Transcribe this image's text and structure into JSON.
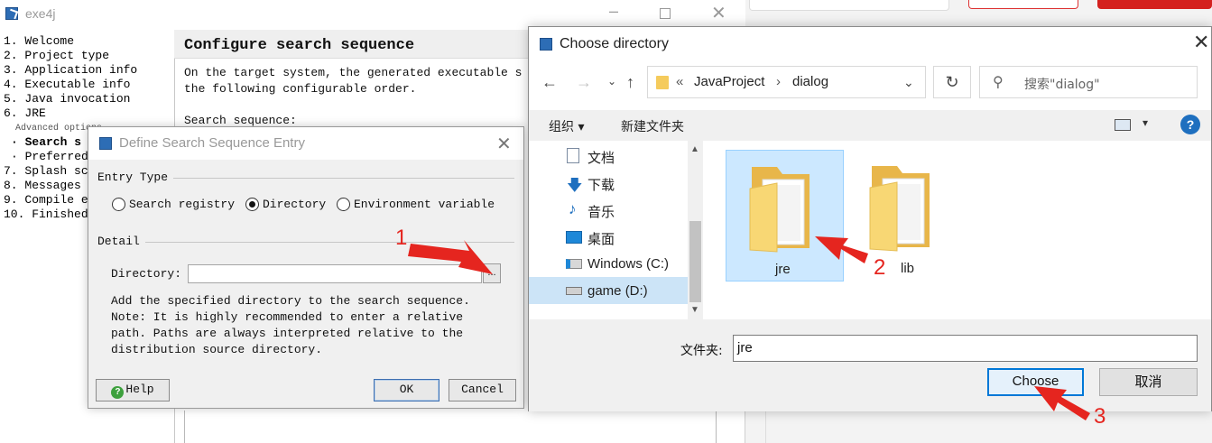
{
  "background_app": {},
  "exe4j": {
    "window_title": "exe4j",
    "steps": [
      "1. Welcome",
      "2. Project type",
      "3. Application info",
      "4. Executable info",
      "5. Java invocation",
      "6. JRE",
      "Advanced options",
      "· Search s",
      "· Preferred",
      "7. Splash sc",
      "8. Messages",
      "9. Compile e",
      "10. Finished"
    ],
    "step_title": "Configure search sequence",
    "step_description": "On the target system, the generated executable s\nthe following configurable order.",
    "search_sequence_label": "Search sequence:"
  },
  "define_entry_dialog": {
    "title": "Define Search Sequence Entry",
    "entry_type_label": "Entry Type",
    "radio_options": [
      {
        "label": "Search registry",
        "checked": false
      },
      {
        "label": "Directory",
        "checked": true
      },
      {
        "label": "Environment variable",
        "checked": false
      }
    ],
    "detail_label": "Detail",
    "directory_label": "Directory:",
    "directory_value": "",
    "browse_label": "...",
    "note": "Add the specified directory to the search sequence.\nNote: It is highly recommended to enter a relative\npath. Paths are always interpreted relative to the\ndistribution source directory.",
    "help_label": "Help",
    "ok_label": "OK",
    "cancel_label": "Cancel"
  },
  "choose_dialog": {
    "title": "Choose directory",
    "breadcrumb": {
      "overflow": "«",
      "items": [
        "JavaProject",
        "dialog"
      ],
      "separator": "›"
    },
    "search_placeholder": "搜索\"dialog\"",
    "toolbar": {
      "organize_label": "组织 ▾",
      "new_folder_label": "新建文件夹",
      "help_glyph": "?"
    },
    "nav_items": [
      "文档",
      "下载",
      "音乐",
      "桌面",
      "Windows (C:)",
      "game (D:)"
    ],
    "selected_nav": "game (D:)",
    "folders": [
      {
        "name": "jre",
        "selected": true
      },
      {
        "name": "lib",
        "selected": false
      }
    ],
    "folder_field_label": "文件夹:",
    "folder_field_value": "jre",
    "choose_label": "Choose",
    "cancel_label": "取消"
  },
  "annotations": {
    "step_labels": [
      "1",
      "2",
      "3"
    ],
    "arrow_color": "#e5251f"
  },
  "colors": {
    "selection_blue": "#cce8ff",
    "accent_blue": "#0078d7",
    "exe4j_logo": "#2d6db5"
  }
}
